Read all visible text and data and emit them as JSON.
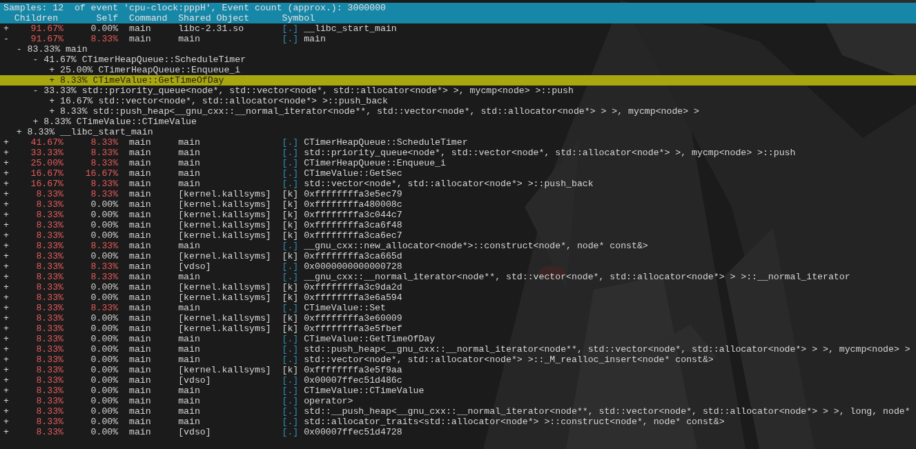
{
  "header": {
    "summary": "Samples: 12  of event 'cpu-clock:pppH', Event count (approx.): 3000000",
    "columns": [
      "Children",
      "Self",
      "Command",
      "Shared Object",
      "Symbol"
    ]
  },
  "rows": [
    {
      "marker": "+",
      "children_pct": "91.67%",
      "children_hot": true,
      "self_pct": "0.00%",
      "self_hot": false,
      "command": "main",
      "shared_object": "libc-2.31.so",
      "kind": "user",
      "privilege": "[.]",
      "symbol": "__libc_start_main"
    },
    {
      "marker": "-",
      "children_pct": "91.67%",
      "children_hot": true,
      "self_pct": "8.33%",
      "self_hot": true,
      "command": "main",
      "shared_object": "main",
      "kind": "user",
      "privilege": "[.]",
      "symbol": "main",
      "children": [
        {
          "marker": "-",
          "percent": "83.33%",
          "symbol": "main",
          "selected": false,
          "children": [
            {
              "marker": "-",
              "percent": "41.67%",
              "symbol": "CTimerHeapQueue::ScheduleTimer",
              "selected": false,
              "children": [
                {
                  "marker": "+",
                  "percent": "25.00%",
                  "symbol": "CTimerHeapQueue::Enqueue_i",
                  "selected": false
                },
                {
                  "marker": "+",
                  "percent": "8.33%",
                  "symbol": "CTimeValue::GetTimeOfDay",
                  "selected": true
                }
              ]
            },
            {
              "marker": "-",
              "percent": "33.33%",
              "symbol": "std::priority_queue<node*, std::vector<node*, std::allocator<node*> >, mycmp<node> >::push",
              "selected": false,
              "children": [
                {
                  "marker": "+",
                  "percent": "16.67%",
                  "symbol": "std::vector<node*, std::allocator<node*> >::push_back",
                  "selected": false
                },
                {
                  "marker": "+",
                  "percent": "8.33%",
                  "symbol": "std::push_heap<__gnu_cxx::__normal_iterator<node**, std::vector<node*, std::allocator<node*> > >, mycmp<node> >",
                  "selected": false
                }
              ]
            },
            {
              "marker": "+",
              "percent": "8.33%",
              "symbol": "CTimeValue::CTimeValue",
              "selected": false
            }
          ]
        },
        {
          "marker": "+",
          "percent": "8.33%",
          "symbol": "__libc_start_main",
          "selected": false
        }
      ]
    },
    {
      "marker": "+",
      "children_pct": "41.67%",
      "children_hot": true,
      "self_pct": "8.33%",
      "self_hot": true,
      "command": "main",
      "shared_object": "main",
      "kind": "user",
      "privilege": "[.]",
      "symbol": "CTimerHeapQueue::ScheduleTimer"
    },
    {
      "marker": "+",
      "children_pct": "33.33%",
      "children_hot": true,
      "self_pct": "8.33%",
      "self_hot": true,
      "command": "main",
      "shared_object": "main",
      "kind": "user",
      "privilege": "[.]",
      "symbol": "std::priority_queue<node*, std::vector<node*, std::allocator<node*> >, mycmp<node> >::push"
    },
    {
      "marker": "+",
      "children_pct": "25.00%",
      "children_hot": true,
      "self_pct": "8.33%",
      "self_hot": true,
      "command": "main",
      "shared_object": "main",
      "kind": "user",
      "privilege": "[.]",
      "symbol": "CTimerHeapQueue::Enqueue_i"
    },
    {
      "marker": "+",
      "children_pct": "16.67%",
      "children_hot": true,
      "self_pct": "16.67%",
      "self_hot": true,
      "command": "main",
      "shared_object": "main",
      "kind": "user",
      "privilege": "[.]",
      "symbol": "CTimeValue::GetSec"
    },
    {
      "marker": "+",
      "children_pct": "16.67%",
      "children_hot": true,
      "self_pct": "8.33%",
      "self_hot": true,
      "command": "main",
      "shared_object": "main",
      "kind": "user",
      "privilege": "[.]",
      "symbol": "std::vector<node*, std::allocator<node*> >::push_back"
    },
    {
      "marker": "+",
      "children_pct": "8.33%",
      "children_hot": true,
      "self_pct": "8.33%",
      "self_hot": true,
      "command": "main",
      "shared_object": "[kernel.kallsyms]",
      "kind": "kernel",
      "privilege": "[k]",
      "symbol": "0xffffffffa3e5ec79"
    },
    {
      "marker": "+",
      "children_pct": "8.33%",
      "children_hot": true,
      "self_pct": "0.00%",
      "self_hot": false,
      "command": "main",
      "shared_object": "[kernel.kallsyms]",
      "kind": "kernel",
      "privilege": "[k]",
      "symbol": "0xffffffffa480008c"
    },
    {
      "marker": "+",
      "children_pct": "8.33%",
      "children_hot": true,
      "self_pct": "0.00%",
      "self_hot": false,
      "command": "main",
      "shared_object": "[kernel.kallsyms]",
      "kind": "kernel",
      "privilege": "[k]",
      "symbol": "0xffffffffa3c044c7"
    },
    {
      "marker": "+",
      "children_pct": "8.33%",
      "children_hot": true,
      "self_pct": "0.00%",
      "self_hot": false,
      "command": "main",
      "shared_object": "[kernel.kallsyms]",
      "kind": "kernel",
      "privilege": "[k]",
      "symbol": "0xffffffffa3ca6f48"
    },
    {
      "marker": "+",
      "children_pct": "8.33%",
      "children_hot": true,
      "self_pct": "0.00%",
      "self_hot": false,
      "command": "main",
      "shared_object": "[kernel.kallsyms]",
      "kind": "kernel",
      "privilege": "[k]",
      "symbol": "0xffffffffa3ca6ec7"
    },
    {
      "marker": "+",
      "children_pct": "8.33%",
      "children_hot": true,
      "self_pct": "8.33%",
      "self_hot": true,
      "command": "main",
      "shared_object": "main",
      "kind": "user",
      "privilege": "[.]",
      "symbol": "__gnu_cxx::new_allocator<node*>::construct<node*, node* const&>"
    },
    {
      "marker": "+",
      "children_pct": "8.33%",
      "children_hot": true,
      "self_pct": "0.00%",
      "self_hot": false,
      "command": "main",
      "shared_object": "[kernel.kallsyms]",
      "kind": "kernel",
      "privilege": "[k]",
      "symbol": "0xffffffffa3ca665d"
    },
    {
      "marker": "+",
      "children_pct": "8.33%",
      "children_hot": true,
      "self_pct": "8.33%",
      "self_hot": true,
      "command": "main",
      "shared_object": "[vdso]",
      "kind": "user",
      "privilege": "[.]",
      "symbol": "0x0000000000000728"
    },
    {
      "marker": "+",
      "children_pct": "8.33%",
      "children_hot": true,
      "self_pct": "8.33%",
      "self_hot": true,
      "command": "main",
      "shared_object": "main",
      "kind": "user",
      "privilege": "[.]",
      "symbol": "__gnu_cxx::__normal_iterator<node**, std::vector<node*, std::allocator<node*> > >::__normal_iterator"
    },
    {
      "marker": "+",
      "children_pct": "8.33%",
      "children_hot": true,
      "self_pct": "0.00%",
      "self_hot": false,
      "command": "main",
      "shared_object": "[kernel.kallsyms]",
      "kind": "kernel",
      "privilege": "[k]",
      "symbol": "0xffffffffa3c9da2d"
    },
    {
      "marker": "+",
      "children_pct": "8.33%",
      "children_hot": true,
      "self_pct": "0.00%",
      "self_hot": false,
      "command": "main",
      "shared_object": "[kernel.kallsyms]",
      "kind": "kernel",
      "privilege": "[k]",
      "symbol": "0xffffffffa3e6a594"
    },
    {
      "marker": "+",
      "children_pct": "8.33%",
      "children_hot": true,
      "self_pct": "8.33%",
      "self_hot": true,
      "command": "main",
      "shared_object": "main",
      "kind": "user",
      "privilege": "[.]",
      "symbol": "CTimeValue::Set"
    },
    {
      "marker": "+",
      "children_pct": "8.33%",
      "children_hot": true,
      "self_pct": "0.00%",
      "self_hot": false,
      "command": "main",
      "shared_object": "[kernel.kallsyms]",
      "kind": "kernel",
      "privilege": "[k]",
      "symbol": "0xffffffffa3e60009"
    },
    {
      "marker": "+",
      "children_pct": "8.33%",
      "children_hot": true,
      "self_pct": "0.00%",
      "self_hot": false,
      "command": "main",
      "shared_object": "[kernel.kallsyms]",
      "kind": "kernel",
      "privilege": "[k]",
      "symbol": "0xffffffffa3e5fbef"
    },
    {
      "marker": "+",
      "children_pct": "8.33%",
      "children_hot": true,
      "self_pct": "0.00%",
      "self_hot": false,
      "command": "main",
      "shared_object": "main",
      "kind": "user",
      "privilege": "[.]",
      "symbol": "CTimeValue::GetTimeOfDay"
    },
    {
      "marker": "+",
      "children_pct": "8.33%",
      "children_hot": true,
      "self_pct": "0.00%",
      "self_hot": false,
      "command": "main",
      "shared_object": "main",
      "kind": "user",
      "privilege": "[.]",
      "symbol": "std::push_heap<__gnu_cxx::__normal_iterator<node**, std::vector<node*, std::allocator<node*> > >, mycmp<node> >"
    },
    {
      "marker": "+",
      "children_pct": "8.33%",
      "children_hot": true,
      "self_pct": "0.00%",
      "self_hot": false,
      "command": "main",
      "shared_object": "main",
      "kind": "user",
      "privilege": "[.]",
      "symbol": "std::vector<node*, std::allocator<node*> >::_M_realloc_insert<node* const&>"
    },
    {
      "marker": "+",
      "children_pct": "8.33%",
      "children_hot": true,
      "self_pct": "0.00%",
      "self_hot": false,
      "command": "main",
      "shared_object": "[kernel.kallsyms]",
      "kind": "kernel",
      "privilege": "[k]",
      "symbol": "0xffffffffa3e5f9aa"
    },
    {
      "marker": "+",
      "children_pct": "8.33%",
      "children_hot": true,
      "self_pct": "0.00%",
      "self_hot": false,
      "command": "main",
      "shared_object": "[vdso]",
      "kind": "user",
      "privilege": "[.]",
      "symbol": "0x00007ffec51d486c"
    },
    {
      "marker": "+",
      "children_pct": "8.33%",
      "children_hot": true,
      "self_pct": "0.00%",
      "self_hot": false,
      "command": "main",
      "shared_object": "main",
      "kind": "user",
      "privilege": "[.]",
      "symbol": "CTimeValue::CTimeValue"
    },
    {
      "marker": "+",
      "children_pct": "8.33%",
      "children_hot": true,
      "self_pct": "0.00%",
      "self_hot": false,
      "command": "main",
      "shared_object": "main",
      "kind": "user",
      "privilege": "[.]",
      "symbol": "operator>"
    },
    {
      "marker": "+",
      "children_pct": "8.33%",
      "children_hot": true,
      "self_pct": "0.00%",
      "self_hot": false,
      "command": "main",
      "shared_object": "main",
      "kind": "user",
      "privilege": "[.]",
      "symbol": "std::__push_heap<__gnu_cxx::__normal_iterator<node**, std::vector<node*, std::allocator<node*> > >, long, node*"
    },
    {
      "marker": "+",
      "children_pct": "8.33%",
      "children_hot": true,
      "self_pct": "0.00%",
      "self_hot": false,
      "command": "main",
      "shared_object": "main",
      "kind": "user",
      "privilege": "[.]",
      "symbol": "std::allocator_traits<std::allocator<node*> >::construct<node*, node* const&>"
    },
    {
      "marker": "+",
      "children_pct": "8.33%",
      "children_hot": true,
      "self_pct": "0.00%",
      "self_hot": false,
      "command": "main",
      "shared_object": "[vdso]",
      "kind": "user",
      "privilege": "[.]",
      "symbol": "0x00007ffec51d4728"
    }
  ]
}
